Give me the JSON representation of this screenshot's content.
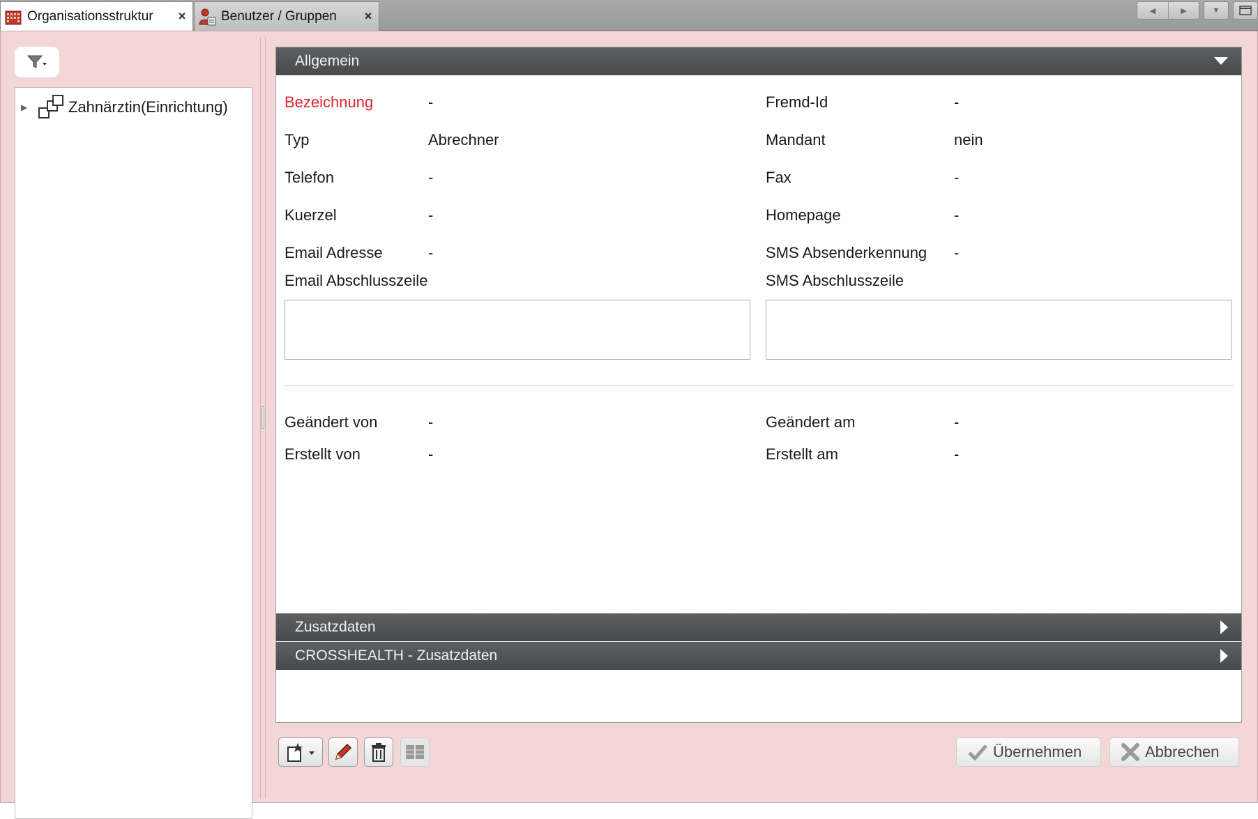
{
  "tabs": [
    {
      "label": "Organisationsstruktur",
      "close": "×",
      "icon": "building-icon",
      "active": true
    },
    {
      "label": "Benutzer / Gruppen",
      "close": "×",
      "icon": "users-icon",
      "active": false
    }
  ],
  "tree": {
    "items": [
      {
        "label": "Zahnärztin(Einrichtung)",
        "icon": "org-unit-icon",
        "expander": "▶"
      }
    ]
  },
  "sections": {
    "allgemein": "Allgemein",
    "zusatzdaten": "Zusatzdaten",
    "crosshealth": "CROSSHEALTH - Zusatzdaten"
  },
  "fields": {
    "bezeichnung": {
      "label": "Bezeichnung",
      "value": "-"
    },
    "fremd_id": {
      "label": "Fremd-Id",
      "value": "-"
    },
    "typ": {
      "label": "Typ",
      "value": "Abrechner"
    },
    "mandant": {
      "label": "Mandant",
      "value": "nein"
    },
    "telefon": {
      "label": "Telefon",
      "value": "-"
    },
    "fax": {
      "label": "Fax",
      "value": "-"
    },
    "kuerzel": {
      "label": "Kuerzel",
      "value": "-"
    },
    "homepage": {
      "label": "Homepage",
      "value": "-"
    },
    "email": {
      "label": "Email Adresse",
      "value": "-"
    },
    "sms_kennung": {
      "label": "SMS Absenderkennung",
      "value": "-"
    },
    "email_abschluss": {
      "label": "Email Abschlusszeile",
      "value": ""
    },
    "sms_abschluss": {
      "label": "SMS Abschlusszeile",
      "value": ""
    },
    "geaendert_von": {
      "label": "Geändert von",
      "value": "-"
    },
    "geaendert_am": {
      "label": "Geändert am",
      "value": "-"
    },
    "erstellt_von": {
      "label": "Erstellt von",
      "value": "-"
    },
    "erstellt_am": {
      "label": "Erstellt am",
      "value": "-"
    }
  },
  "actions": {
    "apply": "Übernehmen",
    "cancel": "Abbrechen"
  },
  "colors": {
    "workspace_bg": "#f3d6d6",
    "header_bg": "#4d5053",
    "required_label": "#e0252a"
  }
}
